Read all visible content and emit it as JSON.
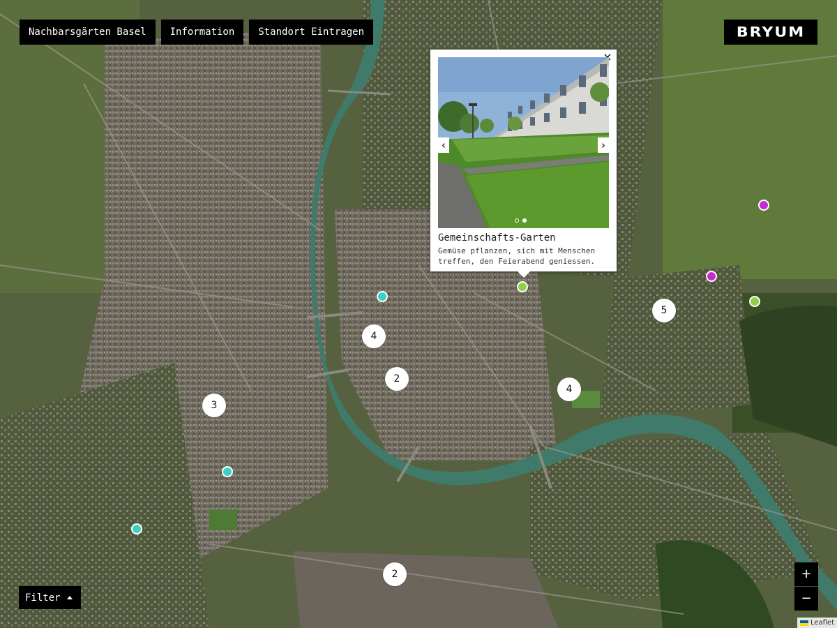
{
  "nav": {
    "items": [
      {
        "label": "Nachbarsgärten Basel"
      },
      {
        "label": "Information"
      },
      {
        "label": "Standort Eintragen"
      }
    ]
  },
  "logo": {
    "text": "BRYUM"
  },
  "popup": {
    "close_glyph": "×",
    "prev_glyph": "‹",
    "next_glyph": "›",
    "title": "Gemeinschafts-Garten",
    "description": "Gemüse pflanzen, sich mit Menschen treffen, den Feierabend geniessen.",
    "slides": 2,
    "active_slide": 2
  },
  "markers": {
    "colors": {
      "teal": "#3fcfc4",
      "green": "#8ed146",
      "magenta": "#c42bd2"
    }
  },
  "clusters": {
    "counts": [
      "4",
      "2",
      "3",
      "4",
      "5",
      "2"
    ]
  },
  "filter": {
    "label": "Filter"
  },
  "zoom": {
    "in": "+",
    "out": "−"
  },
  "attribution": {
    "text": "Leaflet"
  }
}
